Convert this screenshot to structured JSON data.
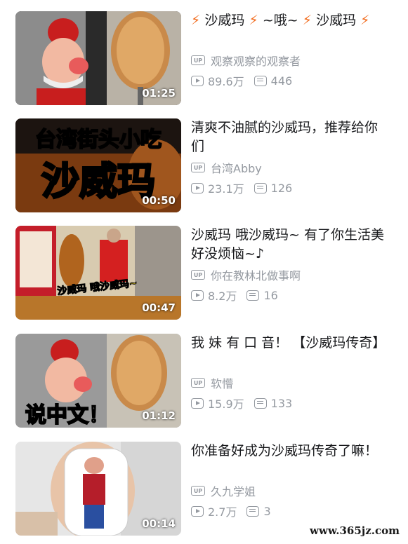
{
  "videos": [
    {
      "title": "⚡ 沙威玛 ⚡ ~哦~ ⚡ 沙威玛 ⚡",
      "uploader": "观察观察的观察者",
      "views": "89.6万",
      "comments": "446",
      "duration": "01:25",
      "thumb_text": ""
    },
    {
      "title": "清爽不油腻的沙威玛，推荐给你们",
      "uploader": "台湾Abby",
      "views": "23.1万",
      "comments": "126",
      "duration": "00:50",
      "thumb_text": "台湾街头小吃",
      "thumb_text2": "沙威玛"
    },
    {
      "title": "沙威玛 哦沙威玛~ 有了你生活美好没烦恼~♪",
      "uploader": "你在教林北做事啊",
      "views": "8.2万",
      "comments": "16",
      "duration": "00:47",
      "thumb_text": "沙威玛 哦沙威玛~"
    },
    {
      "title": "我 妹 有 口 音！ 【沙威玛传奇】",
      "uploader": "软懵",
      "views": "15.9万",
      "comments": "133",
      "duration": "01:12",
      "thumb_text": "说中文！"
    },
    {
      "title": "你准备好成为沙威玛传奇了嘛！",
      "uploader": "久九学姐",
      "views": "2.7万",
      "comments": "3",
      "duration": "00:14",
      "thumb_text": ""
    }
  ],
  "badge": "UP",
  "watermark": "www.365jz.com",
  "colors": {
    "accent": "#f26a1b",
    "meta": "#9499a0",
    "title": "#18191c"
  }
}
